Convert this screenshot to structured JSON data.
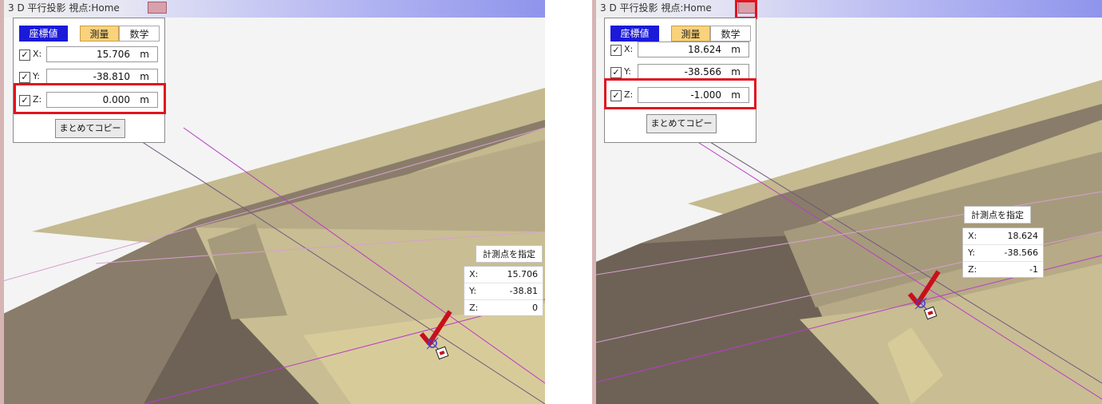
{
  "left": {
    "title": "3 D 平行投影 視点:Home",
    "mode_buttons": {
      "coord": "座標値",
      "survey": "測量",
      "math": "数学"
    },
    "fields": [
      {
        "axis": "X:",
        "value": "15.706",
        "unit": "m",
        "checked": true
      },
      {
        "axis": "Y:",
        "value": "-38.810",
        "unit": "m",
        "checked": true
      },
      {
        "axis": "Z:",
        "value": "0.000",
        "unit": "m",
        "checked": true
      }
    ],
    "copy_label": "まとめてコピー",
    "measure": {
      "title": "計測点を指定",
      "rows": [
        {
          "label": "X:",
          "value": "15.706"
        },
        {
          "label": "Y:",
          "value": "-38.81"
        },
        {
          "label": "Z:",
          "value": "0"
        }
      ]
    }
  },
  "right": {
    "title": "3 D 平行投影 視点:Home",
    "mode_buttons": {
      "coord": "座標値",
      "survey": "測量",
      "math": "数学"
    },
    "fields": [
      {
        "axis": "X:",
        "value": "18.624",
        "unit": "m",
        "checked": true
      },
      {
        "axis": "Y:",
        "value": "-38.566",
        "unit": "m",
        "checked": true
      },
      {
        "axis": "Z:",
        "value": "-1.000",
        "unit": "m",
        "checked": true
      }
    ],
    "copy_label": "まとめてコピー",
    "measure": {
      "title": "計測点を指定",
      "rows": [
        {
          "label": "X:",
          "value": "18.624"
        },
        {
          "label": "Y:",
          "value": "-38.566"
        },
        {
          "label": "Z:",
          "value": "-1"
        }
      ]
    }
  },
  "colors": {
    "highlight": "#e0141e",
    "active_mode": "#1a1ad8",
    "survey_mode": "#f9d27b",
    "cursor_check": "#c8101a",
    "guide_line": "#b83cc8"
  },
  "check_mark": "✓"
}
